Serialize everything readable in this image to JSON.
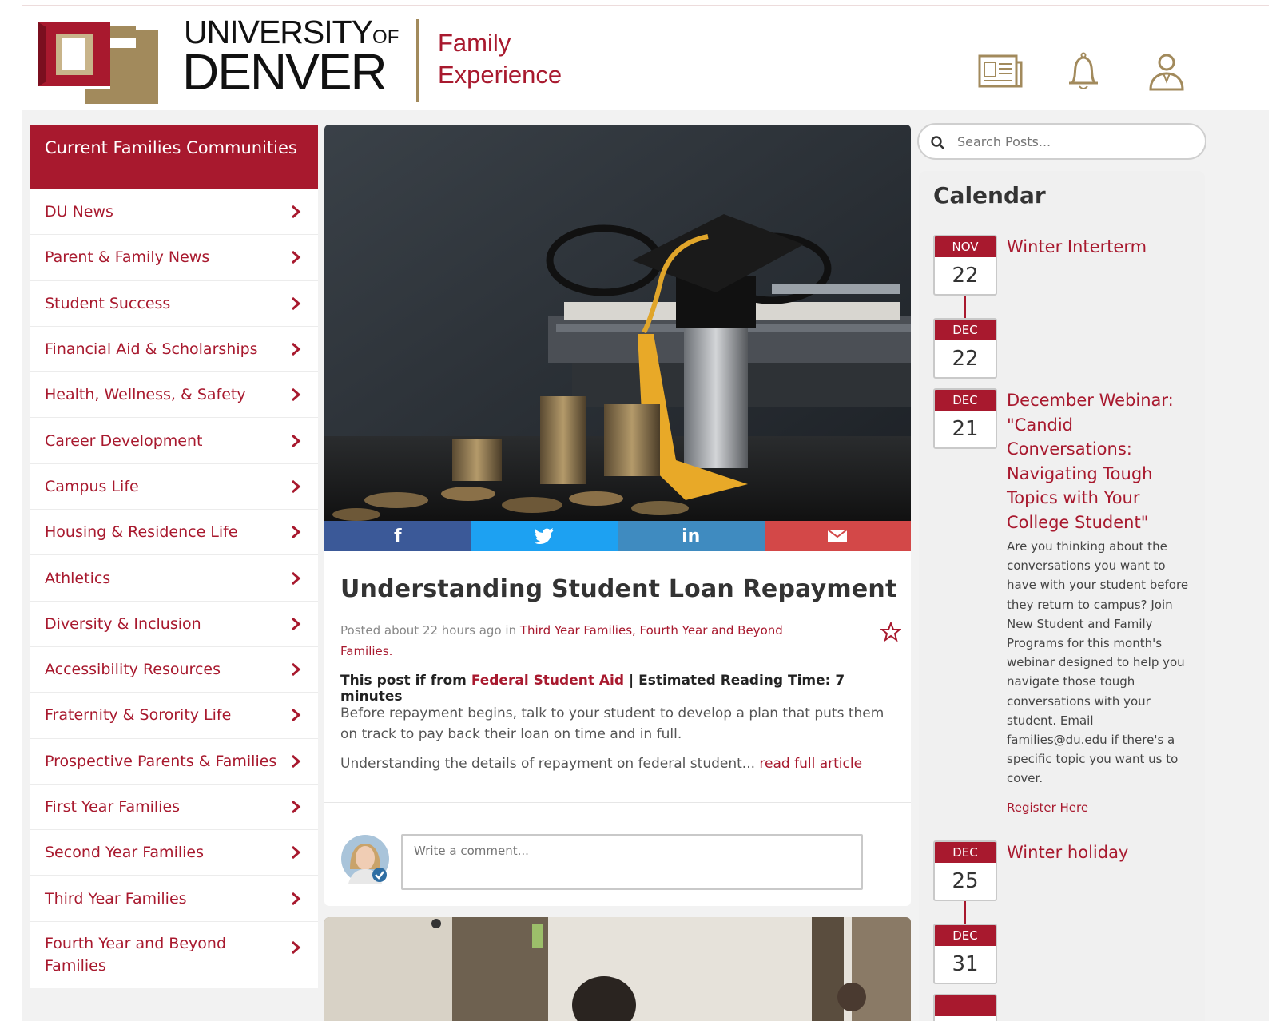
{
  "header": {
    "logo_univ": "UNIVERSITY",
    "logo_of": "OF",
    "logo_denver": "DENVER",
    "logo_family": "Family Experience",
    "icons": [
      "newsletter-icon",
      "bell-icon",
      "user-icon"
    ]
  },
  "sidebar": {
    "heading": "Current Families Communities",
    "items": [
      {
        "label": "DU News"
      },
      {
        "label": "Parent & Family News"
      },
      {
        "label": "Student Success"
      },
      {
        "label": "Financial Aid & Scholarships"
      },
      {
        "label": "Health, Wellness, & Safety"
      },
      {
        "label": "Career Development"
      },
      {
        "label": "Campus Life"
      },
      {
        "label": "Housing & Residence Life"
      },
      {
        "label": "Athletics"
      },
      {
        "label": "Diversity & Inclusion"
      },
      {
        "label": "Accessibility Resources"
      },
      {
        "label": "Fraternity & Sorority Life"
      },
      {
        "label": "Prospective Parents & Families"
      },
      {
        "label": "First Year Families"
      },
      {
        "label": "Second Year Families"
      },
      {
        "label": "Third Year Families"
      },
      {
        "label": "Fourth Year and Beyond Families"
      }
    ]
  },
  "post": {
    "share_labels": [
      "f",
      "",
      "in",
      ""
    ],
    "title": "Understanding Student Loan Repayment",
    "meta_prefix": "Posted about 22 hours ago in",
    "meta_categories": "Third Year Families, Fourth Year and Beyond Families.",
    "source_prefix": "This post if from",
    "source_name": "Federal Student Aid",
    "source_suffix": "| Estimated Reading Time: 7 minutes",
    "excerpt": "Before repayment begins, talk to your student to develop a plan that puts them on track to pay back their loan on time and in full.",
    "more_text": "Understanding the details of repayment on federal student...",
    "read_more": "read full article",
    "comment_placeholder": "Write a comment..."
  },
  "search": {
    "placeholder": "Search Posts..."
  },
  "calendar": {
    "title": "Calendar",
    "events": [
      {
        "start_month": "NOV",
        "start_day": "22",
        "end_month": "DEC",
        "end_day": "22",
        "title": "Winter Interterm"
      },
      {
        "start_month": "DEC",
        "start_day": "21",
        "title": "December Webinar: \"Candid Conversations: Navigating Tough Topics with Your College Student\"",
        "description": "Are you thinking about the conversations you want to have with your student before they return to campus? Join New Student and Family Programs for this month's webinar designed to help you navigate those tough conversations with your student. Email families@du.edu if there's a specific topic you want us to cover.",
        "link": "Register Here"
      },
      {
        "start_month": "DEC",
        "start_day": "25",
        "end_month": "DEC",
        "end_day": "31",
        "title": "Winter holiday"
      }
    ]
  },
  "colors": {
    "brand": "#a8192e",
    "gold": "#a28a5c",
    "facebook": "#3b5998",
    "twitter": "#1da1f2",
    "linkedin": "#3f8bc0",
    "email": "#d34848"
  }
}
